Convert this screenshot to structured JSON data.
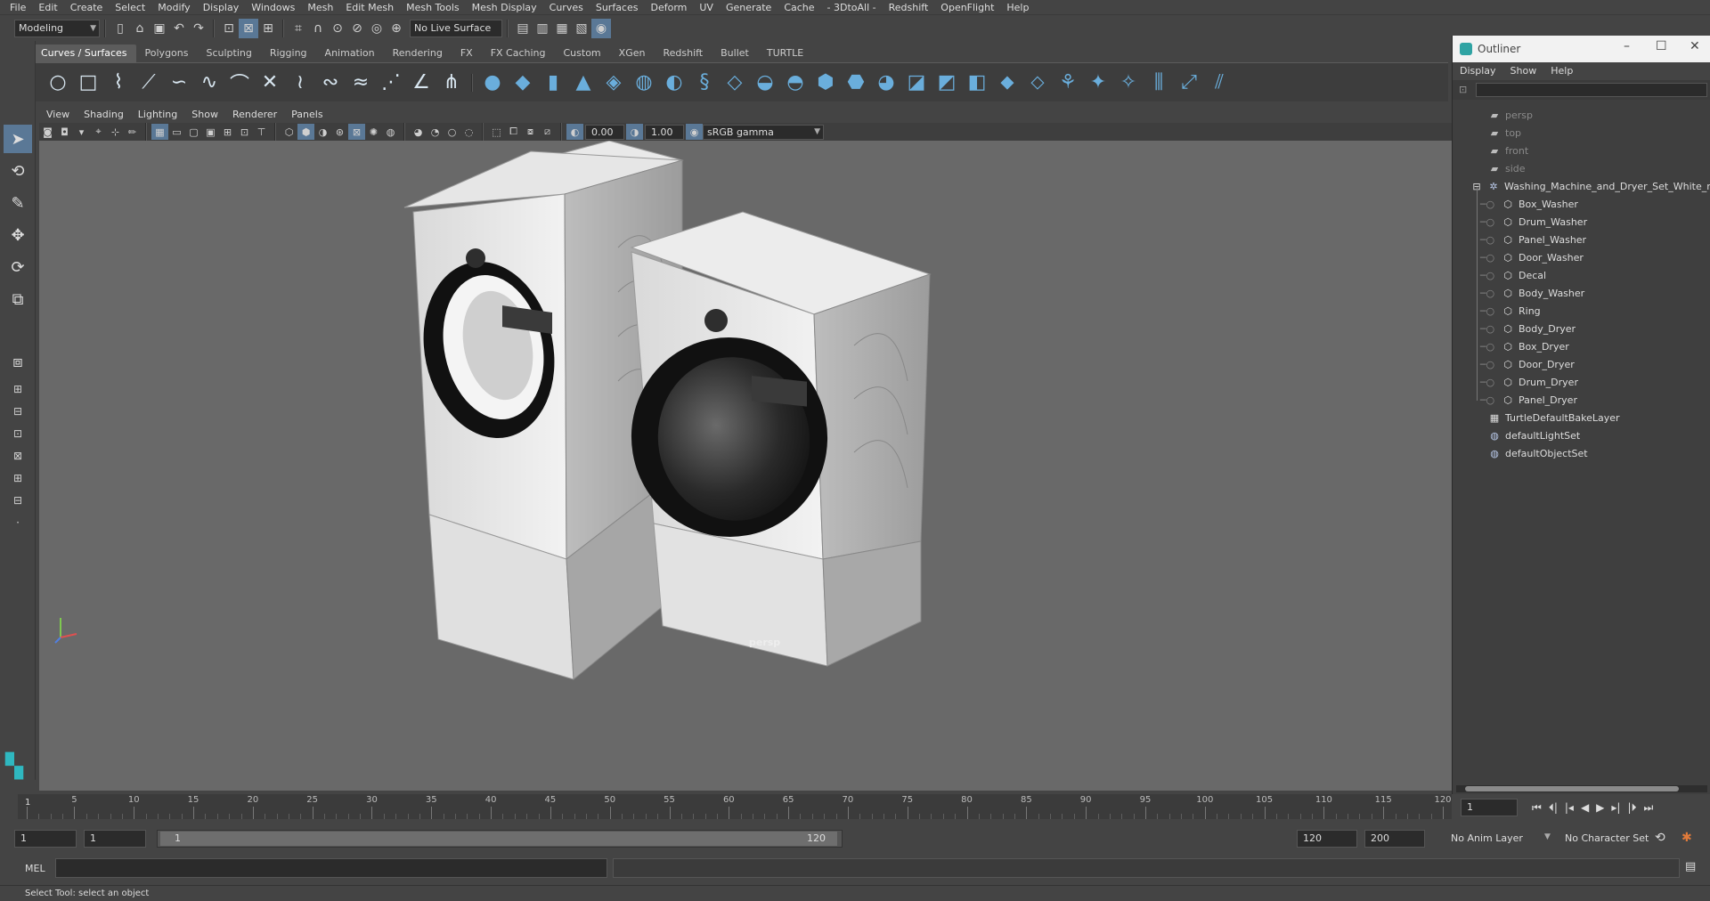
{
  "menubar": [
    "File",
    "Edit",
    "Create",
    "Select",
    "Modify",
    "Display",
    "Windows",
    "Mesh",
    "Edit Mesh",
    "Mesh Tools",
    "Mesh Display",
    "Curves",
    "Surfaces",
    "Deform",
    "UV",
    "Generate",
    "Cache",
    "- 3DtoAll -",
    "Redshift",
    "OpenFlight",
    "Help"
  ],
  "statusline": {
    "workspace": "Modeling",
    "live_surface": "No Live Surface"
  },
  "shelf_tabs": [
    "Curves / Surfaces",
    "Polygons",
    "Sculpting",
    "Rigging",
    "Animation",
    "Rendering",
    "FX",
    "FX Caching",
    "Custom",
    "XGen",
    "Redshift",
    "Bullet",
    "TURTLE"
  ],
  "viewport": {
    "menu": [
      "View",
      "Shading",
      "Lighting",
      "Show",
      "Renderer",
      "Panels"
    ],
    "exposure": "0.00",
    "gamma": "1.00",
    "colorspace": "sRGB gamma",
    "camera_label": "persp"
  },
  "outliner": {
    "title": "Outliner",
    "menu": [
      "Display",
      "Show",
      "Help"
    ],
    "items": [
      {
        "label": "persp",
        "kind": "camera",
        "dim": true
      },
      {
        "label": "top",
        "kind": "camera",
        "dim": true
      },
      {
        "label": "front",
        "kind": "camera",
        "dim": true
      },
      {
        "label": "side",
        "kind": "camera",
        "dim": true
      },
      {
        "label": "Washing_Machine_and_Dryer_Set_White_nc",
        "kind": "group",
        "dim": false
      },
      {
        "label": "Box_Washer",
        "kind": "mesh",
        "dim": false
      },
      {
        "label": "Drum_Washer",
        "kind": "mesh",
        "dim": false
      },
      {
        "label": "Panel_Washer",
        "kind": "mesh",
        "dim": false
      },
      {
        "label": "Door_Washer",
        "kind": "mesh",
        "dim": false
      },
      {
        "label": "Decal",
        "kind": "mesh",
        "dim": false
      },
      {
        "label": "Body_Washer",
        "kind": "mesh",
        "dim": false
      },
      {
        "label": "Ring",
        "kind": "mesh",
        "dim": false
      },
      {
        "label": "Body_Dryer",
        "kind": "mesh",
        "dim": false
      },
      {
        "label": "Box_Dryer",
        "kind": "mesh",
        "dim": false
      },
      {
        "label": "Door_Dryer",
        "kind": "mesh",
        "dim": false
      },
      {
        "label": "Drum_Dryer",
        "kind": "mesh",
        "dim": false
      },
      {
        "label": "Panel_Dryer",
        "kind": "mesh",
        "dim": false
      },
      {
        "label": "TurtleDefaultBakeLayer",
        "kind": "layer",
        "dim": false
      },
      {
        "label": "defaultLightSet",
        "kind": "set",
        "dim": false
      },
      {
        "label": "defaultObjectSet",
        "kind": "set",
        "dim": false
      }
    ]
  },
  "timeline": {
    "labels": [
      "1",
      "5",
      "10",
      "15",
      "20",
      "25",
      "30",
      "35",
      "40",
      "45",
      "50",
      "55",
      "60",
      "65",
      "70",
      "75",
      "80",
      "85",
      "90",
      "95",
      "100",
      "105",
      "110",
      "115",
      "120"
    ],
    "current_frame": "1",
    "current_frame_field": "1"
  },
  "range": {
    "start": "1",
    "playback_start": "1",
    "range_start_label": "1",
    "range_end_label": "120",
    "playback_end": "120",
    "end": "200",
    "anim_layer": "No Anim Layer",
    "character_set": "No Character Set"
  },
  "command": {
    "label": "MEL"
  },
  "helpline": {
    "text": "Select Tool: select an object"
  },
  "colors": {
    "accent": "#5a7896",
    "viewport_bg": "#696969",
    "panel": "#444444"
  }
}
